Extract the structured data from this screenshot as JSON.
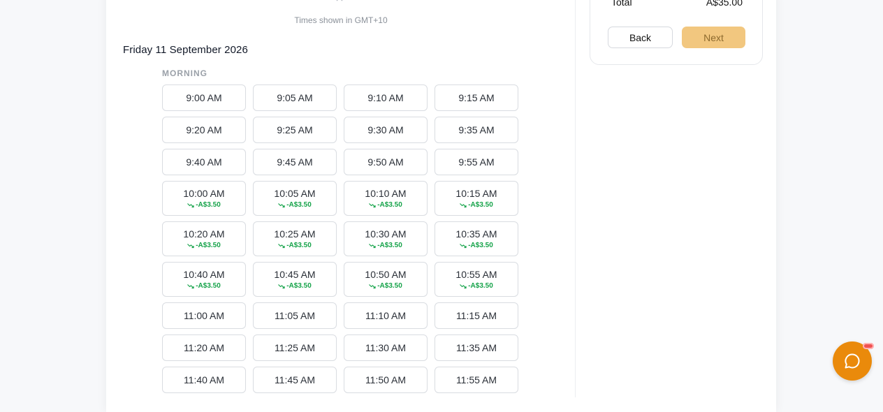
{
  "timezone_note": "Times shown in GMT+10",
  "date_heading": "Friday 11 September 2026",
  "section_label": "MORNING",
  "summary": {
    "total_label": "Total",
    "total_value": "A$35.00",
    "back_label": "Back",
    "next_label": "Next"
  },
  "slots": [
    {
      "time": "9:00 AM",
      "discount": ""
    },
    {
      "time": "9:05 AM",
      "discount": ""
    },
    {
      "time": "9:10 AM",
      "discount": ""
    },
    {
      "time": "9:15 AM",
      "discount": ""
    },
    {
      "time": "9:20 AM",
      "discount": ""
    },
    {
      "time": "9:25 AM",
      "discount": ""
    },
    {
      "time": "9:30 AM",
      "discount": ""
    },
    {
      "time": "9:35 AM",
      "discount": ""
    },
    {
      "time": "9:40 AM",
      "discount": ""
    },
    {
      "time": "9:45 AM",
      "discount": ""
    },
    {
      "time": "9:50 AM",
      "discount": ""
    },
    {
      "time": "9:55 AM",
      "discount": ""
    },
    {
      "time": "10:00 AM",
      "discount": "-A$3.50"
    },
    {
      "time": "10:05 AM",
      "discount": "-A$3.50"
    },
    {
      "time": "10:10 AM",
      "discount": "-A$3.50"
    },
    {
      "time": "10:15 AM",
      "discount": "-A$3.50"
    },
    {
      "time": "10:20 AM",
      "discount": "-A$3.50"
    },
    {
      "time": "10:25 AM",
      "discount": "-A$3.50"
    },
    {
      "time": "10:30 AM",
      "discount": "-A$3.50"
    },
    {
      "time": "10:35 AM",
      "discount": "-A$3.50"
    },
    {
      "time": "10:40 AM",
      "discount": "-A$3.50"
    },
    {
      "time": "10:45 AM",
      "discount": "-A$3.50"
    },
    {
      "time": "10:50 AM",
      "discount": "-A$3.50"
    },
    {
      "time": "10:55 AM",
      "discount": "-A$3.50"
    },
    {
      "time": "11:00 AM",
      "discount": ""
    },
    {
      "time": "11:05 AM",
      "discount": ""
    },
    {
      "time": "11:10 AM",
      "discount": ""
    },
    {
      "time": "11:15 AM",
      "discount": ""
    },
    {
      "time": "11:20 AM",
      "discount": ""
    },
    {
      "time": "11:25 AM",
      "discount": ""
    },
    {
      "time": "11:30 AM",
      "discount": ""
    },
    {
      "time": "11:35 AM",
      "discount": ""
    },
    {
      "time": "11:40 AM",
      "discount": ""
    },
    {
      "time": "11:45 AM",
      "discount": ""
    },
    {
      "time": "11:50 AM",
      "discount": ""
    },
    {
      "time": "11:55 AM",
      "discount": ""
    }
  ],
  "icons": {
    "collapse": "chevron-up-icon",
    "discount": "trending-down-icon",
    "chat": "chat-bubble-icon"
  },
  "colors": {
    "accent": "#ea8a0b",
    "next_disabled": "#f2c77f",
    "discount": "#16a34a"
  }
}
